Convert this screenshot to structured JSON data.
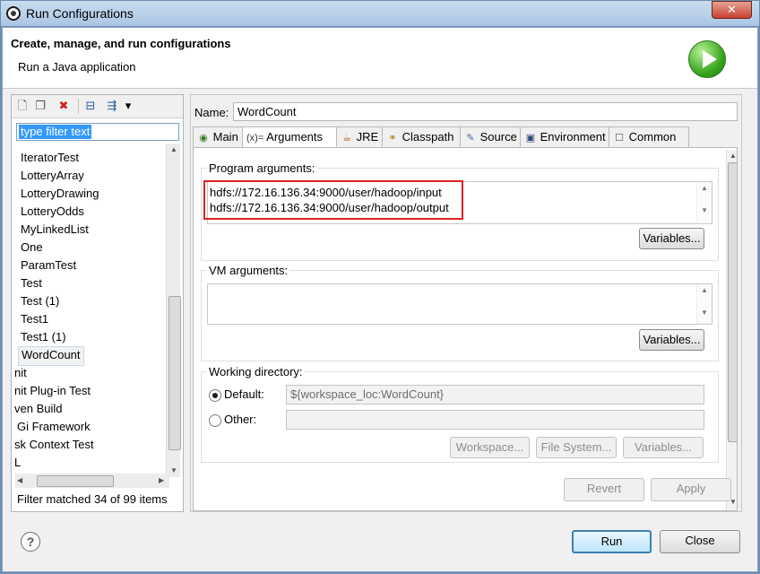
{
  "window": {
    "title": "Run Configurations",
    "close_label": "✕"
  },
  "header": {
    "title": "Create, manage, and run configurations",
    "description": "Run a Java application"
  },
  "left": {
    "toolbar": [
      {
        "name": "new-configuration-icon",
        "glyph": "🗋"
      },
      {
        "name": "duplicate-icon",
        "glyph": "❐"
      },
      {
        "name": "delete-icon",
        "glyph": "✖"
      },
      {
        "name": "collapse-all-icon",
        "glyph": "⊟"
      },
      {
        "name": "filter-icon",
        "glyph": "⇶"
      },
      {
        "name": "view-menu-icon",
        "glyph": "▾"
      }
    ],
    "filter_text": "type filter text",
    "items": [
      "IteratorTest",
      "LotteryArray",
      "LotteryDrawing",
      "LotteryOdds",
      "MyLinkedList",
      "One",
      "ParamTest",
      "Test",
      "Test (1)",
      "Test1",
      "Test1 (1)",
      "WordCount",
      "nit",
      "nit Plug-in Test",
      "ven Build",
      "Gi Framework",
      "sk Context Test",
      "L"
    ],
    "selected_item": "WordCount",
    "status": "Filter matched 34 of 99 items"
  },
  "config": {
    "name_label": "Name:",
    "name_value": "WordCount",
    "tabs": [
      {
        "label": "Main",
        "icon": "main-tab-icon",
        "glyph": "◉"
      },
      {
        "label": "Arguments",
        "icon": "arguments-tab-icon",
        "glyph": "(x)="
      },
      {
        "label": "JRE",
        "icon": "jre-tab-icon",
        "glyph": "☕"
      },
      {
        "label": "Classpath",
        "icon": "classpath-tab-icon",
        "glyph": "⚭"
      },
      {
        "label": "Source",
        "icon": "source-tab-icon",
        "glyph": "✎"
      },
      {
        "label": "Environment",
        "icon": "environment-tab-icon",
        "glyph": "▣"
      },
      {
        "label": "Common",
        "icon": "common-tab-icon",
        "glyph": "☐"
      }
    ],
    "active_tab": "Arguments",
    "program_args_label": "Program arguments:",
    "program_args_lines": [
      "hdfs://172.16.136.34:9000/user/hadoop/input",
      "hdfs://172.16.136.34:9000/user/hadoop/output"
    ],
    "variables_label": "Variables...",
    "vm_args_label": "VM arguments:",
    "vm_args_value": "",
    "working_dir_label": "Working directory:",
    "default_label": "Default:",
    "default_value": "${workspace_loc:WordCount}",
    "other_label": "Other:",
    "other_value": "",
    "workspace_btn": "Workspace...",
    "filesystem_btn": "File System...",
    "wd_variables_btn": "Variables...",
    "revert_btn": "Revert",
    "apply_btn": "Apply"
  },
  "footer": {
    "run_label": "Run",
    "close_label": "Close",
    "help_glyph": "?"
  },
  "colors": {
    "highlight_box": "#e02020",
    "selection": "#3399ff"
  }
}
